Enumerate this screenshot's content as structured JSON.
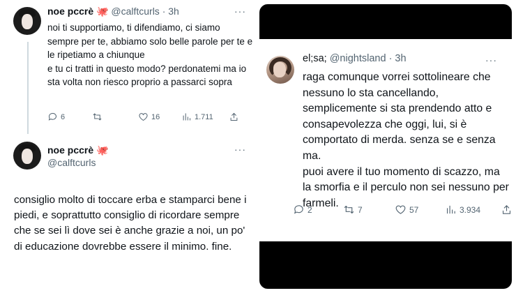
{
  "left_thread": {
    "tweet1": {
      "display_name": "noe pccrè",
      "emoji": "🐙",
      "handle": "@calftcurls",
      "time": "· 3h",
      "more": "···",
      "lines": [
        "noi ti supportiamo, ti difendiamo, ci siamo sempre per te, abbiamo solo belle parole per te e le ripetiamo a chiunque",
        "e tu ci tratti in questo modo? perdonatemi ma io sta volta non riesco proprio a passarci sopra"
      ],
      "replies": "6",
      "retweets": "",
      "likes": "16",
      "views": "1.711"
    },
    "tweet2": {
      "display_name": "noe pccrè",
      "emoji": "🐙",
      "handle": "@calftcurls",
      "more": "···",
      "text": "consiglio molto di toccare erba e stamparci bene i piedi, e soprattutto consiglio di ricordare sempre che se sei lì dove sei è anche grazie a noi, un po' di educazione dovrebbe essere il minimo. fine."
    }
  },
  "right_tweet": {
    "display_name": "el;sa;",
    "handle": "@nightsland",
    "time": "· 3h",
    "more": "···",
    "lines": [
      "raga comunque vorrei sottolineare che nessuno lo sta cancellando, semplicemente si sta prendendo atto e consapevolezza che oggi, lui, si è comportato di merda. senza se e senza ma.",
      "puoi avere il tuo momento di scazzo, ma la smorfia e il perculo non sei nessuno per farmeli."
    ],
    "replies": "2",
    "retweets": "7",
    "likes": "57",
    "views": "3.934"
  },
  "colors": {
    "text": "#0f1419",
    "secondary": "#536471",
    "thread_line": "#cfd9de",
    "emoji_accent": "#e0245e",
    "frame": "#000000"
  },
  "icons": [
    "reply-icon",
    "retweet-icon",
    "like-icon",
    "views-icon",
    "share-icon",
    "octopus-emoji",
    "more-icon"
  ]
}
